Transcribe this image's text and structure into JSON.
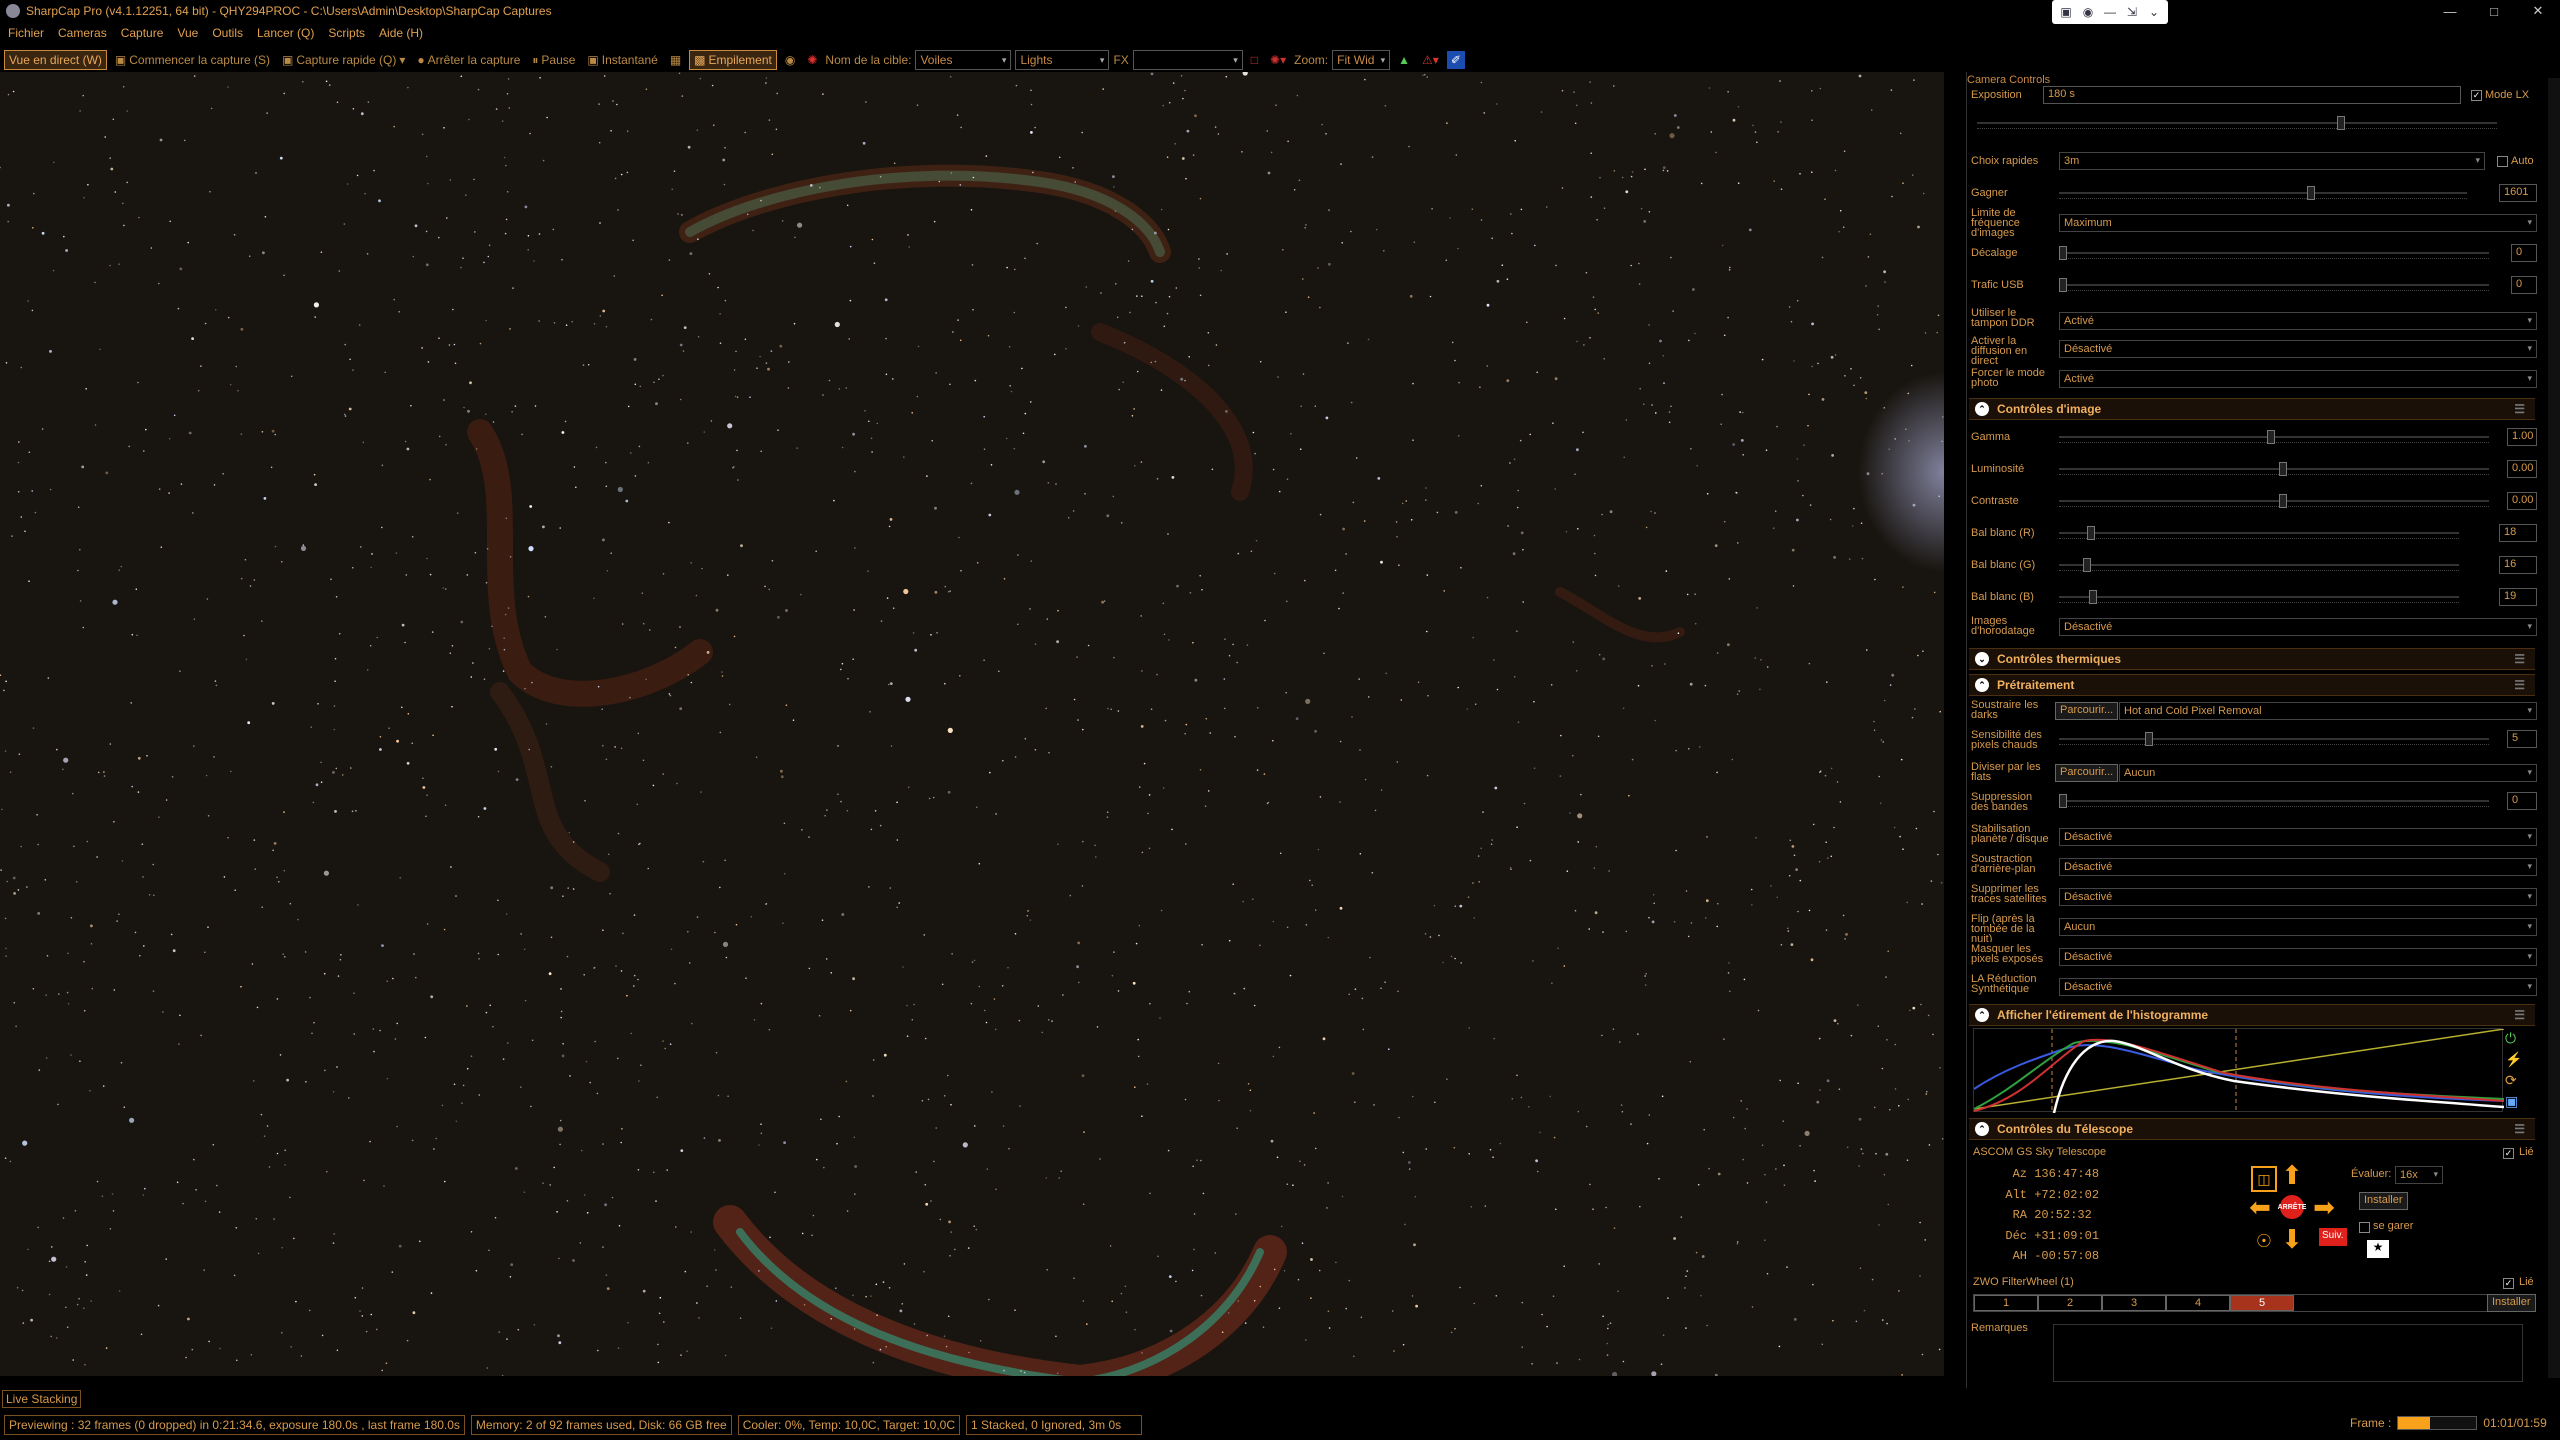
{
  "window": {
    "title": "SharpCap Pro (v4.1.12251, 64 bit) - QHY294PROC - C:\\Users\\Admin\\Desktop\\SharpCap Captures",
    "controls": [
      "—",
      "□",
      "✕"
    ]
  },
  "menu": [
    "Fichier",
    "Cameras",
    "Capture",
    "Vue",
    "Outils",
    "Lancer (Q)",
    "Scripts",
    "Aide (H)"
  ],
  "toolbar": {
    "live_view": "Vue en direct (W)",
    "start_capture": "Commencer la capture (S)",
    "quick_capture": "Capture rapide (Q)",
    "stop_capture": "Arrêter la capture",
    "pause": "Pause",
    "snapshot": "Instantané",
    "stacking": "Empilement",
    "target_label": "Nom de la cible:",
    "target_value": "Voiles",
    "frame_type": "Lights",
    "fx_label": "FX",
    "fx_value": "",
    "zoom_label": "Zoom:",
    "zoom_value": "Fit Wid"
  },
  "camera_controls": {
    "header": "Camera Controls",
    "exposure_label": "Exposition",
    "exposure_value": "180 s",
    "lx_mode_label": "Mode LX",
    "quick_choice_label": "Choix rapides",
    "quick_choice_value": "3m",
    "auto_label": "Auto",
    "gain_label": "Gagner",
    "gain_value": "1601",
    "gain_level": 0.62,
    "frame_rate_label": "Limite de fréquence d'images",
    "frame_rate_value": "Maximum",
    "offset_label": "Décalage",
    "offset_value": "0",
    "usb_label": "Trafic USB",
    "usb_value": "0",
    "ddr_label": "Utiliser le tampon DDR",
    "ddr_value": "Activé",
    "live_stream_label": "Activer la diffusion en direct",
    "live_stream_value": "Désactivé",
    "photo_mode_label": "Forcer le mode photo",
    "photo_mode_value": "Activé"
  },
  "image_controls": {
    "header": "Contrôles d'image",
    "gamma_label": "Gamma",
    "gamma_value": "1.00",
    "brightness_label": "Luminosité",
    "brightness_value": "0.00",
    "contrast_label": "Contraste",
    "contrast_value": "0.00",
    "wb_r_label": "Bal blanc (R)",
    "wb_r_value": "18",
    "wb_g_label": "Bal blanc (G)",
    "wb_g_value": "16",
    "wb_b_label": "Bal blanc (B)",
    "wb_b_value": "19",
    "timestamp_label": "Images d'horodatage",
    "timestamp_value": "Désactivé"
  },
  "thermal": {
    "header": "Contrôles thermiques"
  },
  "preprocessing": {
    "header": "Prétraitement",
    "darks_label": "Soustraire les darks",
    "browse1": "Parcourir...",
    "darks_value": "Hot and Cold Pixel Removal",
    "hot_label": "Sensibilité des pixels chauds",
    "hot_value": "5",
    "flats_label": "Diviser par les flats",
    "browse2": "Parcourir...",
    "flats_value": "Aucun",
    "banding_label": "Suppression des bandes",
    "banding_value": "0",
    "stabilization_label": "Stabilisation planète / disque",
    "stabilization_value": "Désactivé",
    "bgsub_label": "Soustraction d'arrière-plan",
    "bgsub_value": "Désactivé",
    "satellite_label": "Supprimer les traces satellites",
    "satellite_value": "Désactivé",
    "flip_label": "Flip (après la tombée de la nuit)",
    "flip_value": "Aucun",
    "overexposed_label": "Masquer les pixels exposés",
    "overexposed_value": "Désactivé",
    "synthetic_label": "LA Réduction Synthétique",
    "synthetic_value": "Désactivé"
  },
  "histogram": {
    "header": "Afficher l'étirement de l'histogramme"
  },
  "telescope": {
    "header": "Contrôles du Télescope",
    "name": "ASCOM GS Sky Telescope",
    "linked_label": "Lié",
    "coords": [
      {
        "label": "Az",
        "value": "136:47:48"
      },
      {
        "label": "Alt",
        "value": "+72:02:02"
      },
      {
        "label": "RA",
        "value": "20:52:32"
      },
      {
        "label": "Déc",
        "value": "+31:09:01"
      },
      {
        "label": "AH",
        "value": "-00:57:08"
      }
    ],
    "rate_label": "Évaluer:",
    "rate_value": "16x",
    "install": "Installer",
    "park_label": "se garer",
    "stop": "ARRÊTE",
    "sun": "Suiv."
  },
  "filterwheel": {
    "name": "ZWO FilterWheel (1)",
    "linked_label": "Lié",
    "slots": [
      "1",
      "2",
      "3",
      "4",
      "5"
    ],
    "active_slot": 4,
    "install": "Installer"
  },
  "remarks": {
    "label": "Remarques"
  },
  "status": {
    "live_stacking": "Live Stacking",
    "previewing": "Previewing : 32 frames (0 dropped) in 0:21:34.6, exposure 180.0s , last frame 180.0s",
    "memory": "Memory: 2 of 92 frames used, Disk: 66 GB free",
    "cooler": "Cooler: 0%, Temp: 10,0C, Target: 10,0C",
    "stacked": "1 Stacked, 0 Ignored, 3m 0s",
    "frame_label": "Frame :",
    "frame_progress": 0.4,
    "time": "01:01/01:59"
  },
  "colors": {
    "accent": "#d79a4c",
    "background": "#000000",
    "active_slot": "#a8331d",
    "arrow": "#f7a21a",
    "stop": "#e0201a"
  }
}
